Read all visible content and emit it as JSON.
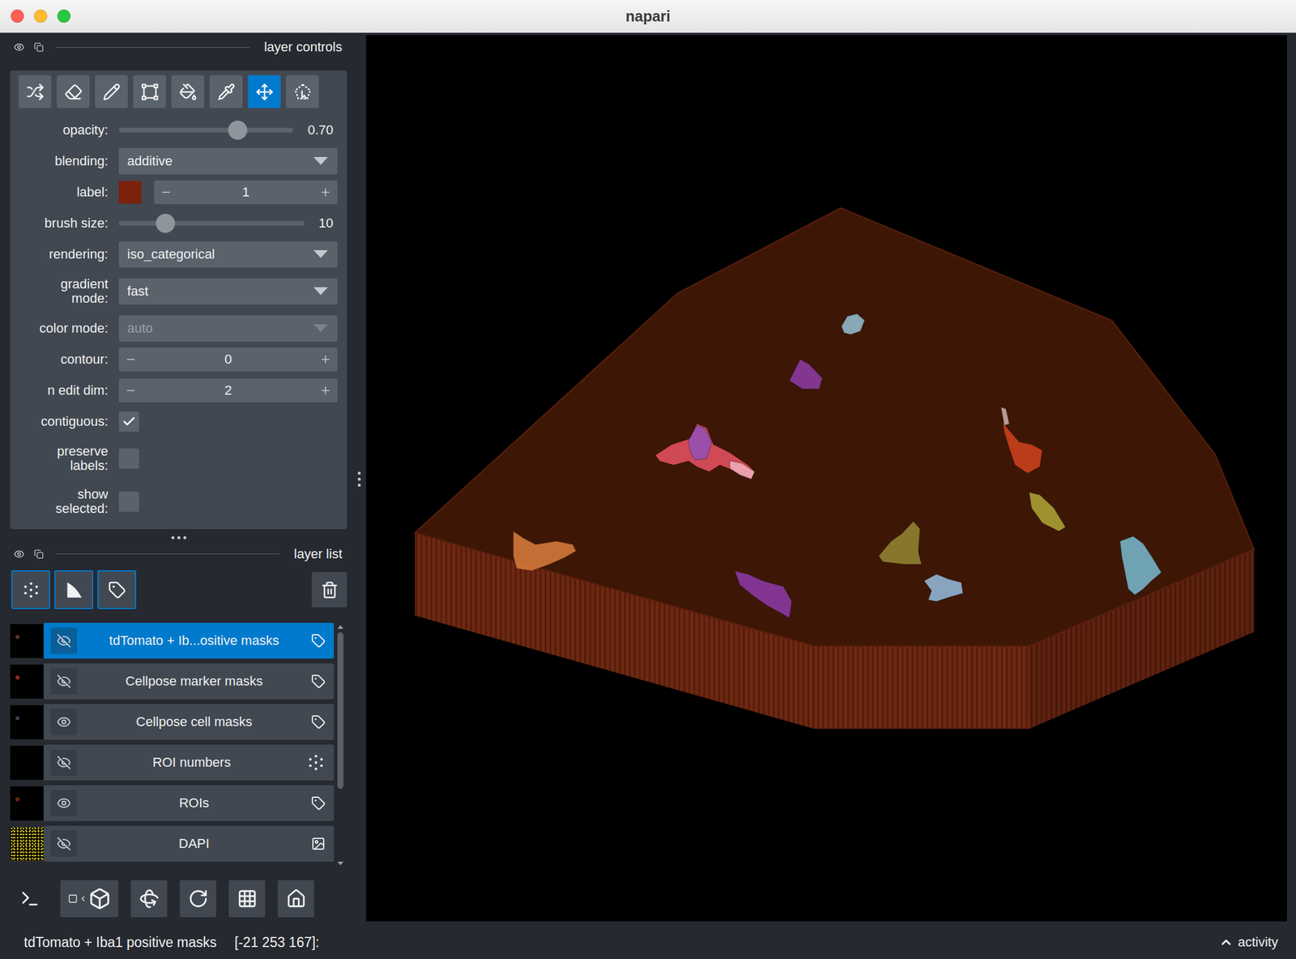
{
  "window": {
    "title": "napari"
  },
  "layer_controls": {
    "title": "layer controls",
    "tools": [
      {
        "selected": false
      },
      {
        "selected": false
      },
      {
        "selected": false
      },
      {
        "selected": false
      },
      {
        "selected": false
      },
      {
        "selected": false
      },
      {
        "selected": true
      },
      {
        "selected": false
      }
    ],
    "rows": [
      {
        "kind": "slider",
        "label": "opacity:",
        "level": 0.68,
        "reading": "0.70"
      },
      {
        "kind": "dropdown",
        "label": "blending:",
        "value": "additive",
        "disabled": false
      },
      {
        "kind": "swatch-spin",
        "label": "label:",
        "value": "1",
        "color": "#7a220c"
      },
      {
        "kind": "slider",
        "label": "brush size:",
        "level": 0.25,
        "reading": "10"
      },
      {
        "kind": "dropdown",
        "label": "rendering:",
        "value": "iso_categorical",
        "disabled": false
      },
      {
        "kind": "dropdown",
        "label": "gradient mode:",
        "value": "fast",
        "disabled": false
      },
      {
        "kind": "dropdown",
        "label": "color mode:",
        "value": "auto",
        "disabled": true
      },
      {
        "kind": "spin",
        "label": "contour:",
        "value": "0"
      },
      {
        "kind": "spin",
        "label": "n edit dim:",
        "value": "2"
      },
      {
        "kind": "checkbox",
        "label": "contiguous:",
        "checked": true
      },
      {
        "kind": "checkbox",
        "label": "preserve labels:",
        "checked": false
      },
      {
        "kind": "checkbox",
        "label": "show selected:",
        "checked": false
      }
    ]
  },
  "layer_list": {
    "title": "layer list",
    "layers": [
      {
        "name": "tdTomato + Ib...ositive masks",
        "visible": false,
        "selected": true,
        "kind": "labels",
        "thumbnail": "#5a3228"
      },
      {
        "name": "Cellpose marker masks",
        "visible": false,
        "selected": false,
        "kind": "labels",
        "thumbnail": "#8a2a20"
      },
      {
        "name": "Cellpose cell masks",
        "visible": true,
        "selected": false,
        "kind": "labels",
        "thumbnail": "#3a3a50"
      },
      {
        "name": "ROI numbers",
        "visible": false,
        "selected": false,
        "kind": "points",
        "thumbnail": "#000000"
      },
      {
        "name": "ROIs",
        "visible": true,
        "selected": false,
        "kind": "labels",
        "thumbnail": "#6a2410"
      },
      {
        "name": "DAPI",
        "visible": false,
        "selected": false,
        "kind": "image",
        "thumbnail": "#c8b820"
      }
    ]
  },
  "canvas": {
    "cells": [
      {
        "color": "#8fb8c8"
      },
      {
        "color": "#8a3a9e"
      },
      {
        "color": "#e0505e"
      },
      {
        "color": "#9650b4"
      },
      {
        "color": "#f0a8b8"
      },
      {
        "color": "#c8401c"
      },
      {
        "color": "#c8a8a8"
      },
      {
        "color": "#a8a034"
      },
      {
        "color": "#d2783a"
      },
      {
        "color": "#8e8232"
      },
      {
        "color": "#8838a0"
      },
      {
        "color": "#90b4d4"
      },
      {
        "color": "#74b2c8"
      }
    ]
  },
  "status_bar": {
    "layer": "tdTomato + Iba1 positive masks",
    "coords": "[-21 253 167]:",
    "activity": "activity"
  }
}
